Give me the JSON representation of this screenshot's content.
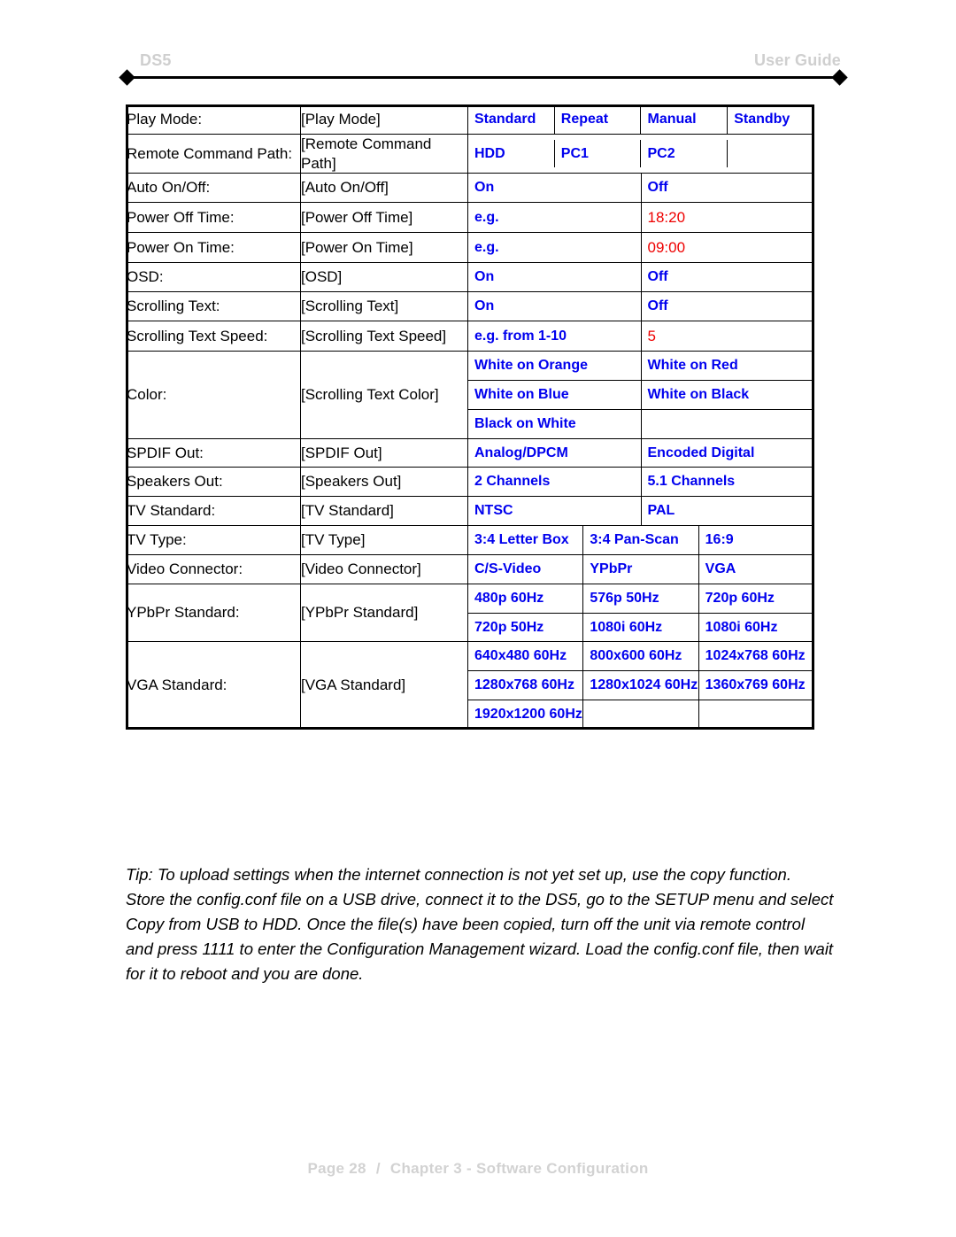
{
  "header": {
    "left_label": "DS5",
    "right_label": "User Guide"
  },
  "colors": {
    "option_blue": "#0000ee",
    "value_red": "#ee0000",
    "header_gray": "#cfcfcf",
    "footer_gray": "#d2d2d2",
    "border_black": "#000000"
  },
  "table": {
    "rows": [
      {
        "label": "Play Mode:",
        "token": "[Play Mode]",
        "options": [
          [
            "Standard",
            "Repeat",
            "Manual",
            "Standby"
          ]
        ]
      },
      {
        "label": "Remote Command Path:",
        "token": "[Remote Command Path]",
        "options": [
          [
            "HDD",
            "PC1",
            "PC2",
            ""
          ]
        ]
      },
      {
        "label": "Auto On/Off:",
        "token": "[Auto On/Off]",
        "options": [
          [
            "On",
            "Off"
          ]
        ]
      },
      {
        "label": "Power Off Time:",
        "token": "[Power Off Time]",
        "options": [
          [
            "e.g.",
            "18:20"
          ]
        ]
      },
      {
        "label": "Power On Time:",
        "token": "[Power On Time]",
        "options": [
          [
            "e.g.",
            "09:00"
          ]
        ]
      },
      {
        "label": "OSD:",
        "token": "[OSD]",
        "options": [
          [
            "On",
            "Off"
          ]
        ]
      },
      {
        "label": "Scrolling Text:",
        "token": "[Scrolling Text]",
        "options": [
          [
            "On",
            "Off"
          ]
        ]
      },
      {
        "label": "Scrolling Text Speed:",
        "token": "[Scrolling Text Speed]",
        "options": [
          [
            "e.g. from 1-10",
            "5"
          ]
        ]
      },
      {
        "label": "Color:",
        "token": "[Scrolling Text Color]",
        "options": [
          [
            "White on Orange",
            "White on Red"
          ],
          [
            "White on Blue",
            "White on Black"
          ],
          [
            "Black on White",
            ""
          ]
        ]
      },
      {
        "label": "SPDIF Out:",
        "token": "[SPDIF Out]",
        "options": [
          [
            "Analog/DPCM",
            "Encoded Digital"
          ]
        ]
      },
      {
        "label": "Speakers Out:",
        "token": "[Speakers Out]",
        "options": [
          [
            "2 Channels",
            "5.1 Channels"
          ]
        ]
      },
      {
        "label": "TV Standard:",
        "token": "[TV Standard]",
        "options": [
          [
            "NTSC",
            "PAL"
          ]
        ]
      },
      {
        "label": "TV Type:",
        "token": "[TV Type]",
        "options": [
          [
            "3:4 Letter Box",
            "3:4 Pan-Scan",
            "16:9"
          ]
        ]
      },
      {
        "label": "Video Connector:",
        "token": "[Video Connector]",
        "options": [
          [
            "C/S-Video",
            "YPbPr",
            "VGA"
          ]
        ]
      },
      {
        "label": "YPbPr Standard:",
        "token": "[YPbPr Standard]",
        "options": [
          [
            "480p 60Hz",
            "576p 50Hz",
            "720p 60Hz"
          ],
          [
            "720p 50Hz",
            "1080i 60Hz",
            "1080i 60Hz"
          ]
        ]
      },
      {
        "label": "VGA Standard:",
        "token": "[VGA Standard]",
        "options": [
          [
            "640x480 60Hz",
            "800x600 60Hz",
            "1024x768 60Hz"
          ],
          [
            "1280x768 60Hz",
            "1280x1024 60Hz",
            "1360x769 60Hz"
          ],
          [
            "1920x1200 60Hz",
            "",
            ""
          ]
        ]
      }
    ]
  },
  "tip": {
    "text": "Tip: To upload settings when the internet connection is not yet set up, use the copy function. Store the config.conf file on a USB drive, connect it to the DS5, go to the SETUP menu and select Copy from USB to HDD. Once the file(s) have been copied, turn off the unit via remote control and press 1111 to enter the Configuration Management wizard. Load the config.conf file, then wait for it to reboot and you are done."
  },
  "footer": {
    "page": "Page 28",
    "separator": "/",
    "chapter": "Chapter 3 - Software Configuration"
  }
}
